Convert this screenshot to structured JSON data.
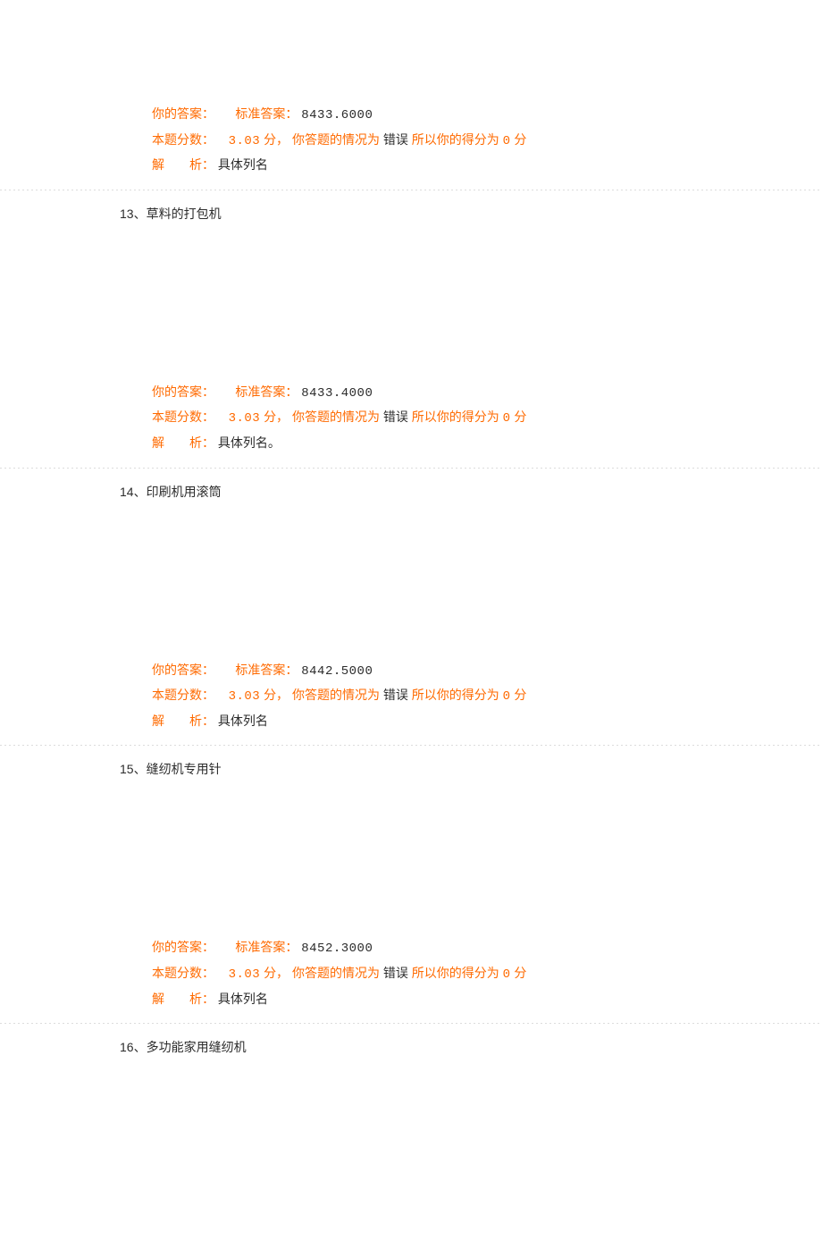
{
  "labels": {
    "your_answer": "你的答案：",
    "standard_answer": "标准答案：",
    "score_prefix": "本题分数：",
    "score_unit": "分，",
    "status_prefix": "你答题的情况为",
    "tail_prefix": "所以你的得分为",
    "tail_unit": "分",
    "analysis_label": "解  析：",
    "separator": "、"
  },
  "items": [
    {
      "standard_answer": "8433.6000",
      "score": "3.03",
      "status": "错误",
      "earned": "0",
      "analysis": "具体列名",
      "next_q_num": "13",
      "next_q_text": "草料的打包机"
    },
    {
      "standard_answer": "8433.4000",
      "score": "3.03",
      "status": "错误",
      "earned": "0",
      "analysis": "具体列名。",
      "next_q_num": "14",
      "next_q_text": "印刷机用滚筒"
    },
    {
      "standard_answer": "8442.5000",
      "score": "3.03",
      "status": "错误",
      "earned": "0",
      "analysis": "具体列名",
      "next_q_num": "15",
      "next_q_text": "缝纫机专用针"
    },
    {
      "standard_answer": "8452.3000",
      "score": "3.03",
      "status": "错误",
      "earned": "0",
      "analysis": "具体列名",
      "next_q_num": "16",
      "next_q_text": "多功能家用缝纫机"
    }
  ]
}
